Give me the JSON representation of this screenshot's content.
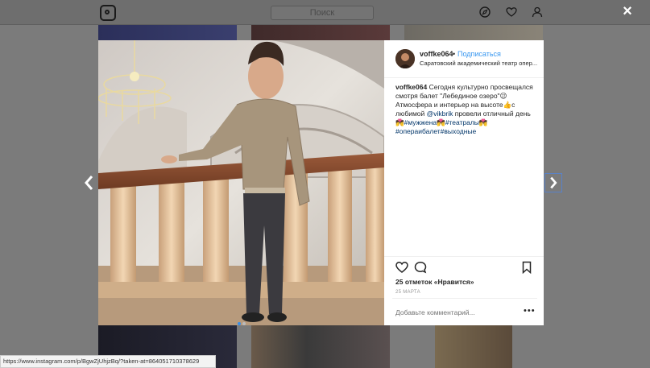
{
  "background": {
    "search_placeholder": "Поиск"
  },
  "modal": {
    "close_label": "×",
    "post": {
      "username": "voffke064",
      "separator": "•",
      "follow_label": "Подписаться",
      "location": "Саратовский академический театр опер...",
      "caption": {
        "author": "voffke064",
        "part1": " Сегодня культурно просвещался смотря балет \"Лебединое озеро\"😉 Атмосфера и интерьер на высоте👍с любимой ",
        "mention": "@vikbrik",
        "part2": " провели отличный день 💏",
        "hashtags": "#мужжена💏#театралы💏 #оперaибалет#выходные"
      },
      "likes": "25 отметок «Нравится»",
      "date": "25 МАРТА",
      "comment_placeholder": "Добавьте комментарий...",
      "more_label": "•••"
    }
  },
  "status_bar": {
    "url": "https://www.instagram.com/p/BgwZjUhjzBq/?taken-at=864051710378629"
  },
  "icons": [
    "instagram-logo-icon",
    "compass-icon",
    "heart-icon",
    "profile-icon",
    "chevron-left-icon",
    "chevron-right-icon",
    "like-icon",
    "comment-icon",
    "bookmark-icon"
  ]
}
